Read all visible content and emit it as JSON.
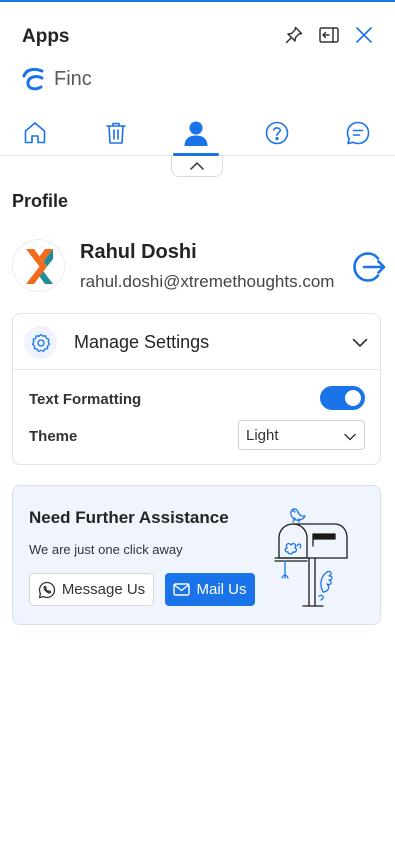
{
  "header": {
    "title": "Apps"
  },
  "brand": {
    "name": "Finc",
    "color": "#1a73e8"
  },
  "nav": {
    "tabs": [
      {
        "id": "home",
        "icon": "home-icon",
        "active": false
      },
      {
        "id": "delete",
        "icon": "trash-icon",
        "active": false
      },
      {
        "id": "profile",
        "icon": "user-icon",
        "active": true
      },
      {
        "id": "help",
        "icon": "help-circle-icon",
        "active": false
      },
      {
        "id": "chat",
        "icon": "chat-icon",
        "active": false
      }
    ]
  },
  "profile": {
    "section_title": "Profile",
    "name": "Rahul Doshi",
    "email": "rahul.doshi@xtremethoughts.com"
  },
  "settings": {
    "title": "Manage Settings",
    "text_formatting_label": "Text Formatting",
    "text_formatting_enabled": true,
    "theme_label": "Theme",
    "theme_value": "Light"
  },
  "assistance": {
    "title": "Need Further Assistance",
    "subtitle": "We are just one click away",
    "message_label": "Message Us",
    "mail_label": "Mail Us"
  },
  "colors": {
    "accent": "#1a73e8",
    "avatar_orange": "#f26b1d",
    "avatar_teal": "#1f8c9a",
    "card_bg": "#f0f4fd"
  }
}
